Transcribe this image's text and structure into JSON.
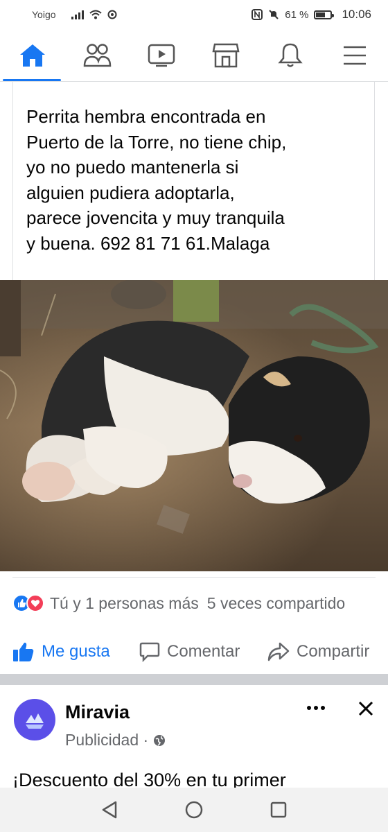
{
  "status_bar": {
    "carrier": "Yoigo",
    "battery": "61 %",
    "battery_level": 0.61,
    "time": "10:06"
  },
  "nav": {
    "tabs": [
      "home-icon",
      "friends-icon",
      "watch-icon",
      "marketplace-icon",
      "notifications-icon",
      "menu-icon"
    ],
    "active": "home-icon",
    "accent": "#1877f2"
  },
  "post": {
    "text_lines": [
      "Perrita  hembra encontrada en",
      "Puerto de la Torre, no tiene chip,",
      "yo no puedo mantenerla si",
      "alguien pudiera adoptarla,",
      "parece jovencita y muy tranquila",
      "y buena. 692 81 71 61.Malaga"
    ],
    "reactions_text": "Tú y 1 personas más",
    "shares_text": "5 veces compartido",
    "like_label": "Me gusta",
    "comment_label": "Comentar",
    "share_label": "Compartir"
  },
  "ad": {
    "name": "Miravia",
    "subtitle": "Publicidad ·",
    "text": "¡Descuento   del 30% en tu primer"
  },
  "system_nav": [
    "back-icon",
    "home-circle-icon",
    "recents-icon"
  ]
}
